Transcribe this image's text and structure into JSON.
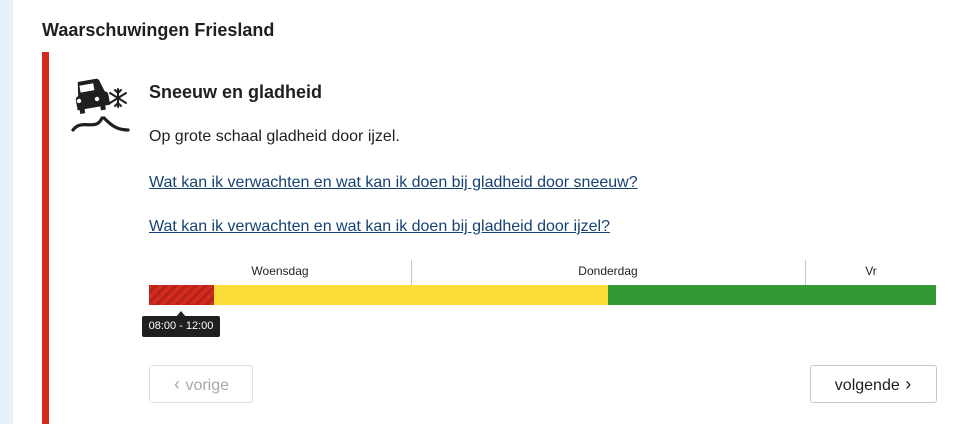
{
  "region_heading": "Waarschuwingen Friesland",
  "warning": {
    "icon": "slippery-car-snowflake-icon",
    "title": "Sneeuw en gladheid",
    "description": "Op grote schaal gladheid door ijzel.",
    "links": [
      "Wat kan ik verwachten en wat kan ik doen bij gladheid door sneeuw?",
      "Wat kan ik verwachten en wat kan ik doen bij gladheid door ijzel?"
    ],
    "severity_color": "#d52b1e"
  },
  "timeline": {
    "days": [
      "Woensdag",
      "Donderdag",
      "Vr"
    ],
    "segments": [
      {
        "level": "red",
        "color": "#d52b1e",
        "share": 0.083
      },
      {
        "level": "yellow",
        "color": "#fcdd3a",
        "share": 0.5
      },
      {
        "level": "green",
        "color": "#339933",
        "share": 0.417
      }
    ],
    "tooltip": "08:00 - 12:00"
  },
  "nav": {
    "prev_label": "vorige",
    "next_label": "volgende",
    "prev_icon": "chevron-left-icon",
    "next_icon": "chevron-right-icon"
  }
}
